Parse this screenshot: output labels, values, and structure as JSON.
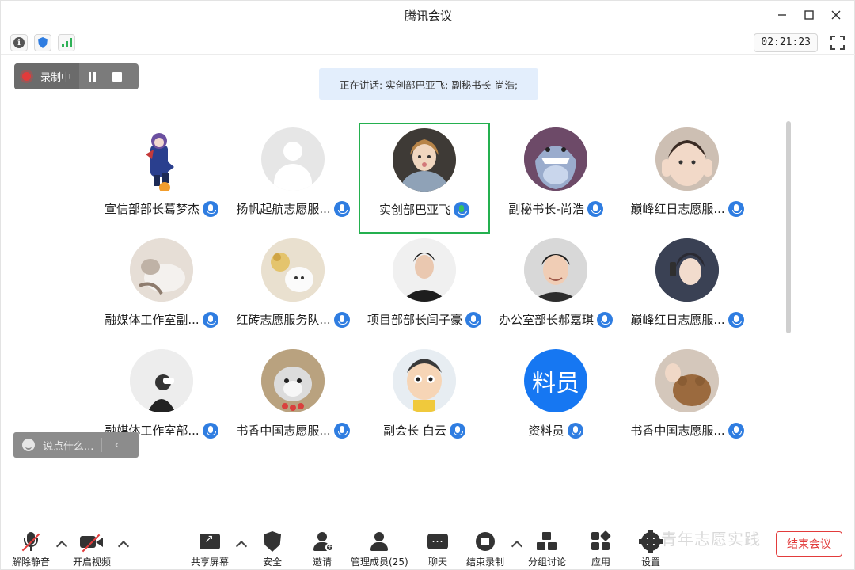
{
  "window": {
    "title": "腾讯会议"
  },
  "infobar": {
    "timer": "02:21:23"
  },
  "recording": {
    "label": "录制中"
  },
  "speaking": {
    "text": "正在讲话: 实创部巴亚飞; 副秘书长-尚浩;"
  },
  "participants": [
    {
      "name": "宣信部部长葛梦杰",
      "avatar": "anime-character"
    },
    {
      "name": "扬帆起航志愿服...",
      "avatar": "default-person"
    },
    {
      "name": "实创部巴亚飞",
      "avatar": "painted-portrait",
      "speaking": true
    },
    {
      "name": "副秘书长-尚浩",
      "avatar": "shark-cartoon"
    },
    {
      "name": "巅峰红日志愿服...",
      "avatar": "child-photo"
    },
    {
      "name": "融媒体工作室副...",
      "avatar": "cat-photo"
    },
    {
      "name": "红砖志愿服务队...",
      "avatar": "flower-bear"
    },
    {
      "name": "项目部部长闫子豪",
      "avatar": "man-photo"
    },
    {
      "name": "办公室部长郝嘉琪",
      "avatar": "boy-photo"
    },
    {
      "name": "巅峰红日志愿服...",
      "avatar": "anime-boy"
    },
    {
      "name": "融媒体工作室部...",
      "avatar": "bw-figure"
    },
    {
      "name": "书香中国志愿服...",
      "avatar": "cat-flowers"
    },
    {
      "name": "副会长 白云",
      "avatar": "cartoon-boy"
    },
    {
      "name": "资料员",
      "avatar": "text-avatar",
      "avatar_text": "料员"
    },
    {
      "name": "书香中国志愿服...",
      "avatar": "teddy-bear"
    }
  ],
  "chat": {
    "placeholder": "说点什么..."
  },
  "toolbar": {
    "mute": "解除静音",
    "video": "开启视频",
    "share": "共享屏幕",
    "security": "安全",
    "invite": "邀请",
    "members": "管理成员(25)",
    "chat": "聊天",
    "end_record": "结束录制",
    "breakout": "分组讨论",
    "apps": "应用",
    "settings": "设置"
  },
  "end_meeting": "结束会议",
  "watermark": "青年志愿实践",
  "colors": {
    "accent": "#2f7de1",
    "speaking_border": "#24b04f",
    "danger": "#e23b3b",
    "banner": "#e3eefc"
  }
}
